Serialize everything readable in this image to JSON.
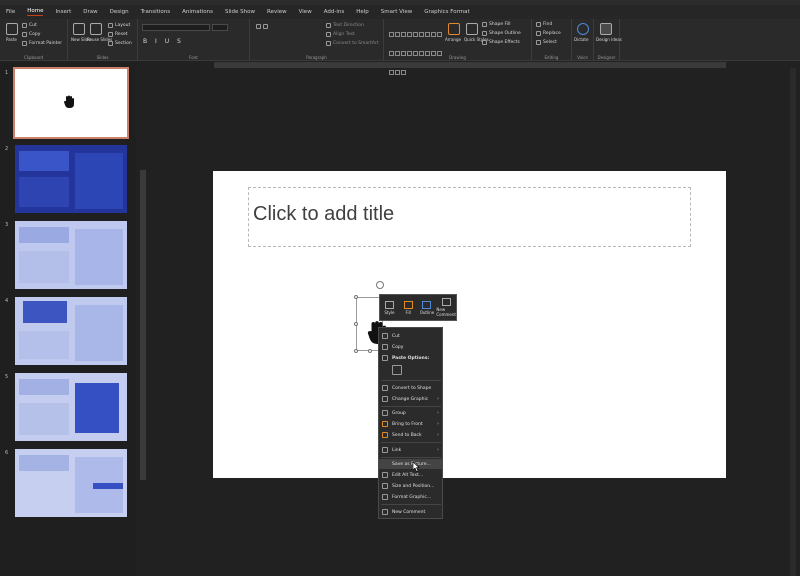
{
  "tabs": [
    "File",
    "Home",
    "Insert",
    "Draw",
    "Design",
    "Transitions",
    "Animations",
    "Slide Show",
    "Review",
    "View",
    "Add-ins",
    "Help",
    "Smart View",
    "Graphics Format"
  ],
  "ribbon": {
    "clipboard": {
      "label": "Clipboard",
      "paste": "Paste",
      "cut": "Cut",
      "copy": "Copy",
      "format_painter": "Format Painter"
    },
    "slides": {
      "label": "Slides",
      "new_slide": "New Slide",
      "reuse": "Reuse Slides",
      "layout": "Layout",
      "reset": "Reset",
      "section": "Section"
    },
    "font": {
      "label": "Font"
    },
    "paragraph": {
      "label": "Paragraph",
      "text_direction": "Text Direction",
      "align_text": "Align Text",
      "smartart": "Convert to SmartArt"
    },
    "drawing": {
      "label": "Drawing",
      "arrange": "Arrange",
      "quick_styles": "Quick Styles",
      "shape_fill": "Shape Fill",
      "shape_outline": "Shape Outline",
      "shape_effects": "Shape Effects"
    },
    "editing": {
      "label": "Editing",
      "find": "Find",
      "replace": "Replace",
      "select": "Select"
    },
    "voice": {
      "label": "Voice",
      "dictate": "Dictate"
    },
    "designer": {
      "label": "Designer",
      "design_ideas": "Design Ideas"
    }
  },
  "thumbnails": [
    "1",
    "2",
    "3",
    "4",
    "5",
    "6"
  ],
  "slide": {
    "title_placeholder": "Click to add title"
  },
  "mini_toolbar": [
    "Style",
    "Fill",
    "Outline",
    "New Comment"
  ],
  "context_menu": [
    {
      "label": "Cut"
    },
    {
      "label": "Copy"
    },
    {
      "label": "Paste Options:"
    },
    {
      "label": "Convert to Shape"
    },
    {
      "label": "Change Graphic",
      "submenu": true
    },
    {
      "label": "Group",
      "submenu": true
    },
    {
      "label": "Bring to Front",
      "submenu": true
    },
    {
      "label": "Send to Back",
      "submenu": true
    },
    {
      "label": "Link",
      "submenu": true
    },
    {
      "label": "Save as Picture...",
      "highlighted": true
    },
    {
      "label": "Edit Alt Text..."
    },
    {
      "label": "Size and Position..."
    },
    {
      "label": "Format Graphic..."
    },
    {
      "label": "New Comment"
    }
  ],
  "colors": {
    "accent": "#c43e1c",
    "selected_thumb_border": "#c9816b"
  }
}
